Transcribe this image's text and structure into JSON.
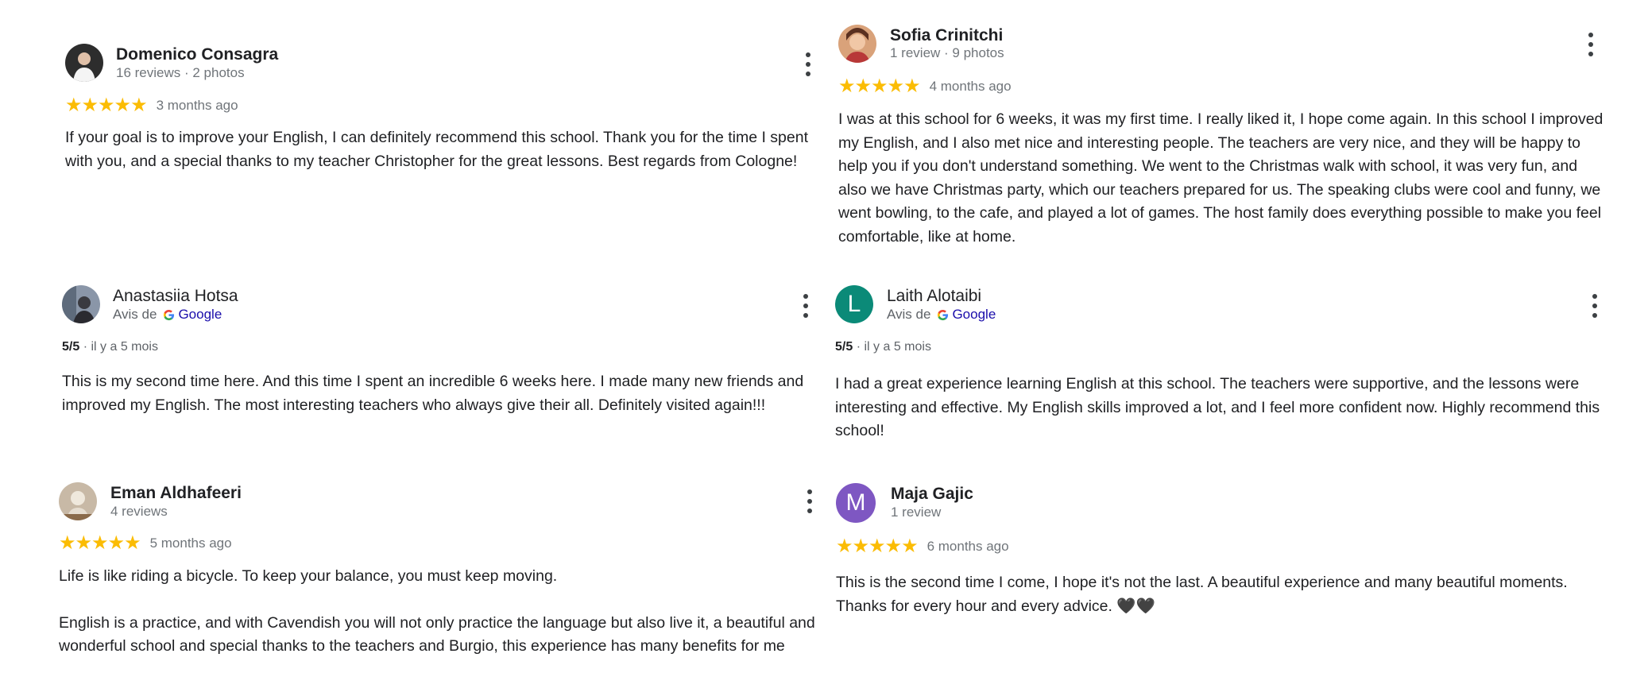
{
  "reviews": [
    {
      "name": "Domenico Consagra",
      "meta": "16 reviews · 2 photos",
      "stars": "★★★★★",
      "time": "3 months ago",
      "text": "If your goal is to improve your English, I can definitely recommend this school. Thank you for the time I spent with you, and a special thanks to my teacher Christopher for the great lessons. Best regards from Cologne!"
    },
    {
      "name": "Sofia Crinitchi",
      "meta": "1 review · 9 photos",
      "stars": "★★★★★",
      "time": "4 months ago",
      "text": "I was at this school for 6 weeks, it was my first time. I really liked it, I hope come again. In this school I improved my English, and I also met nice and interesting people. The teachers are very nice, and they will be happy to help you if you don't understand something. We went to the Christmas walk with school, it was very fun, and also we have Christmas party, which our teachers prepared for us. The speaking clubs were cool and funny, we went bowling, to the cafe, and played a lot of games. The host family does everything possible to make you feel comfortable, like at home."
    },
    {
      "name": "Anastasiia Hotsa",
      "source_prefix": "Avis de",
      "source_name": "Google",
      "score": "5/5",
      "time": " · il y a 5 mois",
      "text": "This is my second time here. And this time I spent an incredible 6 weeks here. I made many new friends and improved my English. The most interesting teachers who always give their all. Definitely visited again!!!"
    },
    {
      "name": "Laith Alotaibi",
      "initial": "L",
      "avatar_color": "#0b8a78",
      "source_prefix": "Avis de",
      "source_name": "Google",
      "score": "5/5",
      "time": " · il y a 5 mois",
      "text": "I had a great experience learning English at this school. The teachers were supportive, and the lessons were interesting and effective. My English skills improved a lot, and I feel more confident now. Highly recommend this school!"
    },
    {
      "name": "Eman Aldhafeeri",
      "meta": "4 reviews",
      "stars": "★★★★★",
      "time": "5 months ago",
      "text_p1": "Life is like riding a bicycle. To keep your balance, you must keep moving.",
      "text_p2": "English is a practice, and with Cavendish you will not only practice the language but also live it, a beautiful and wonderful school and special thanks to the teachers and Burgio, this experience has many benefits for me"
    },
    {
      "name": "Maja Gajic",
      "initial": "M",
      "avatar_color": "#7e57c2",
      "meta": "1 review",
      "stars": "★★★★★",
      "time": "6 months ago",
      "text": "This is the second time I come, I hope it's not the last. A beautiful experience and many beautiful moments. Thanks for every hour and every advice. 🖤🖤"
    }
  ],
  "colors": {
    "star": "#fbbc04",
    "link": "#1a0dab",
    "meta": "#70757a"
  },
  "icons": [
    "avatar-photo",
    "google-g-icon",
    "more-options-icon",
    "star-icon"
  ]
}
